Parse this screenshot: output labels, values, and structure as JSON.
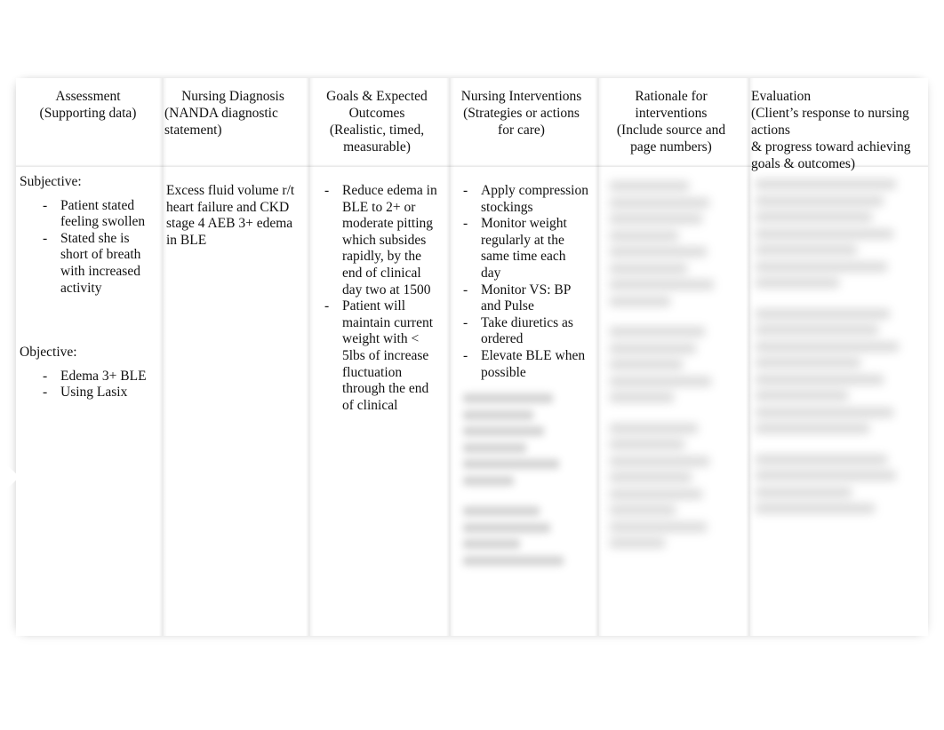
{
  "document": {
    "type": "nursing-care-plan-table"
  },
  "table": {
    "headers": [
      {
        "id": "assessment",
        "lines": [
          "Assessment",
          "(Supporting data)"
        ],
        "align": "center"
      },
      {
        "id": "nursing-diagnosis",
        "lines": [
          "Nursing Diagnosis",
          "(NANDA diagnostic",
          "statement)"
        ],
        "align": "left"
      },
      {
        "id": "goals-outcomes",
        "lines": [
          "Goals & Expected",
          "Outcomes",
          "(Realistic, timed,",
          "measurable)"
        ],
        "align": "center"
      },
      {
        "id": "nursing-interventions",
        "lines": [
          "Nursing Interventions",
          "(Strategies or actions",
          "for care)"
        ],
        "align": "center"
      },
      {
        "id": "rationale",
        "lines": [
          "Rationale for",
          "interventions",
          "(Include source and",
          "page numbers)"
        ],
        "align": "center"
      },
      {
        "id": "evaluation",
        "lines": [
          "Evaluation",
          "(Client’s response to nursing actions",
          "& progress toward achieving",
          " goals & outcomes)"
        ],
        "align": "left"
      }
    ],
    "body": {
      "assessment": {
        "subjective_label": "Subjective:",
        "subjective_items": [
          "Patient stated feeling swollen",
          "Stated she is short of breath with increased activity"
        ],
        "objective_label": "Objective:",
        "objective_items": [
          "Edema 3+ BLE",
          "Using Lasix"
        ]
      },
      "nursing_diagnosis": {
        "text": "Excess fluid volume r/t heart failure and CKD stage 4 AEB 3+ edema in BLE"
      },
      "goals_outcomes": {
        "items": [
          "Reduce edema in BLE to 2+ or moderate pitting which subsides rapidly, by the end of clinical day two at 1500",
          "Patient will maintain current weight with < 5lbs of increase fluctuation through the end of clinical"
        ],
        "truncated": true
      },
      "nursing_interventions": {
        "items": [
          "Apply compression stockings",
          "Monitor weight regularly at the same time each day",
          "Monitor VS: BP and Pulse",
          "Take diuretics as ordered",
          "Elevate BLE when possible"
        ],
        "redacted_note": "additional content blurred / illegible"
      },
      "rationale": {
        "redacted_note": "content blurred / illegible"
      },
      "evaluation": {
        "redacted_note": "content blurred / illegible"
      }
    }
  },
  "colors": {
    "page_background": "#ffffff",
    "text": "#111111",
    "separator": "rgba(0,0,0,0.085)",
    "redacted_block": "#6d6d6d"
  }
}
